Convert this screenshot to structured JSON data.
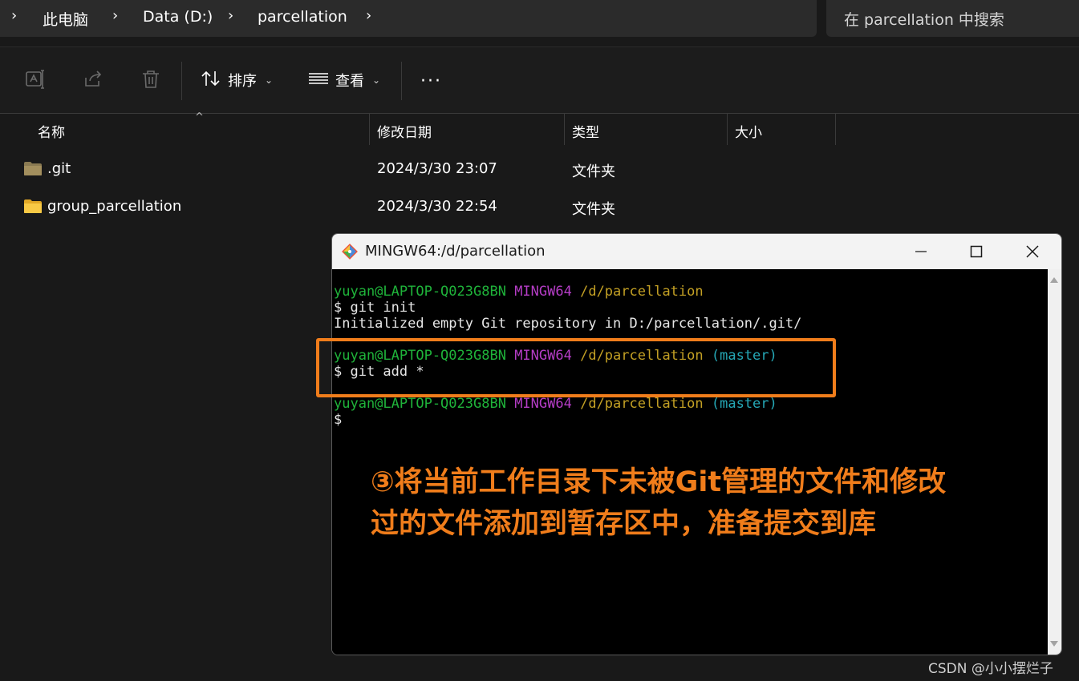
{
  "address": {
    "crumbs": [
      "此电脑",
      "Data (D:)",
      "parcellation"
    ]
  },
  "search": {
    "placeholder": "在 parcellation 中搜索"
  },
  "toolbar": {
    "sort_label": "排序",
    "view_label": "查看",
    "more_label": "···"
  },
  "columns": {
    "name": "名称",
    "date": "修改日期",
    "type": "类型",
    "size": "大小"
  },
  "files": [
    {
      "name": ".git",
      "date": "2024/3/30 23:07",
      "type": "文件夹",
      "icon": "folder-icon-dim"
    },
    {
      "name": "group_parcellation",
      "date": "2024/3/30 22:54",
      "type": "文件夹",
      "icon": "folder-icon"
    }
  ],
  "terminal": {
    "title": "MINGW64:/d/parcellation",
    "lines": {
      "p1_user": "yuyan@LAPTOP-Q023G8BN",
      "p1_env": "MINGW64",
      "p1_path": "/d/parcellation",
      "c1": "$ git init",
      "o1": "Initialized empty Git repository in D:/parcellation/.git/",
      "p2_user": "yuyan@LAPTOP-Q023G8BN",
      "p2_env": "MINGW64",
      "p2_path": "/d/parcellation",
      "p2_branch": "(master)",
      "c2": "$ git add *",
      "p3_user": "yuyan@LAPTOP-Q023G8BN",
      "p3_env": "MINGW64",
      "p3_path": "/d/parcellation",
      "p3_branch": "(master)",
      "c3": "$"
    }
  },
  "annotation": {
    "line1": "③将当前工作目录下未被Git管理的文件和修改",
    "line2": "过的文件添加到暂存区中，准备提交到库"
  },
  "watermark": "CSDN @小小摆烂子",
  "colors": {
    "accent_orange": "#f07d1b",
    "prompt_green": "#1fb33a",
    "prompt_magenta": "#b53dc6",
    "prompt_yellow": "#c3a024",
    "prompt_cyan": "#25a8b6"
  }
}
